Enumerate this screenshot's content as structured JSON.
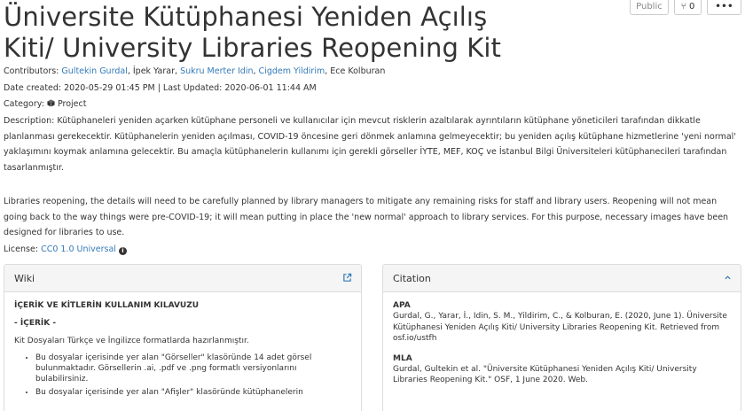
{
  "project": {
    "title": "Üniversite Kütüphanesi Yeniden Açılış Kiti/ University Libraries Reopening Kit"
  },
  "actions": {
    "public_label": "Public",
    "fork_label": "0",
    "more_label": "•••"
  },
  "contributors": {
    "label": "Contributors:",
    "people": [
      {
        "name": "Gultekin Gurdal",
        "linked": true
      },
      {
        "name": "İpek Yarar",
        "linked": false
      },
      {
        "name": "Sukru Merter Idin",
        "linked": true
      },
      {
        "name": "Cigdem Yildirim",
        "linked": true
      },
      {
        "name": "Ece Kolburan",
        "linked": false
      }
    ]
  },
  "dates": {
    "text": "Date created: 2020-05-29 01:45 PM | Last Updated: 2020-06-01 11:44 AM"
  },
  "category": {
    "label": "Category:",
    "value": "Project",
    "icon": "cube-icon"
  },
  "description": {
    "label": "Description:",
    "text_tr": "Kütüphaneleri yeniden açarken kütüphane personeli ve kullanıcılar için mevcut risklerin azaltılarak ayrıntıların kütüphane yöneticileri tarafından dikkatle planlanması gerekecektir. Kütüphanelerin yeniden açılması, COVID-19 öncesine geri dönmek anlamına gelmeyecektir; bu yeniden açılış kütüphane hizmetlerine 'yeni normal' yaklaşımını koymak anlamına gelecektir. Bu amaçla kütüphanelerin kullanımı için gerekli görseller İYTE, MEF, KOÇ ve İstanbul Bilgi Üniversiteleri kütüphanecileri tarafından tasarlanmıştır.",
    "text_en": "Libraries reopening, the details will need to be carefully planned by library managers to mitigate any remaining risks for staff and library users. Reopening will not mean going back to the way things were pre-COVID-19; it will mean putting in place the 'new normal' approach to library services. For this purpose, necessary images have been designed for libraries to use."
  },
  "license": {
    "label": "License:",
    "value": "CC0 1.0 Universal",
    "icon": "info-icon"
  },
  "wiki": {
    "title": "Wiki",
    "heading": "İÇERİK VE KİTLERİN KULLANIM KILAVUZU",
    "subheading": "- İÇERİK -",
    "intro": "Kit Dosyaları Türkçe ve İngilizce formatlarda hazırlanmıştır.",
    "items": [
      "Bu dosyalar içerisinde yer alan \"Görseller\" klasöründe 14 adet görsel bulunmaktadır. Görsellerin .ai, .pdf ve .png formatlı versiyonlarını bulabilirsiniz.",
      "Bu dosyalar içerisinde yer alan \"Afişler\" klasöründe kütüphanelerin"
    ]
  },
  "citation": {
    "title": "Citation",
    "apa_label": "APA",
    "apa_text": "Gurdal, G., Yarar, İ., Idin, S. M., Yildirim, C., & Kolburan, E. (2020, June 1). Üniversite Kütüphanesi Yeniden Açılış Kiti/ University Libraries Reopening Kit. Retrieved from osf.io/ustfh",
    "mla_label": "MLA",
    "mla_text": "Gurdal, Gultekin et al. \"Üniversite Kütüphanesi Yeniden Açılış Kiti/ University Libraries Reopening Kit.\" OSF, 1 June 2020. Web."
  }
}
